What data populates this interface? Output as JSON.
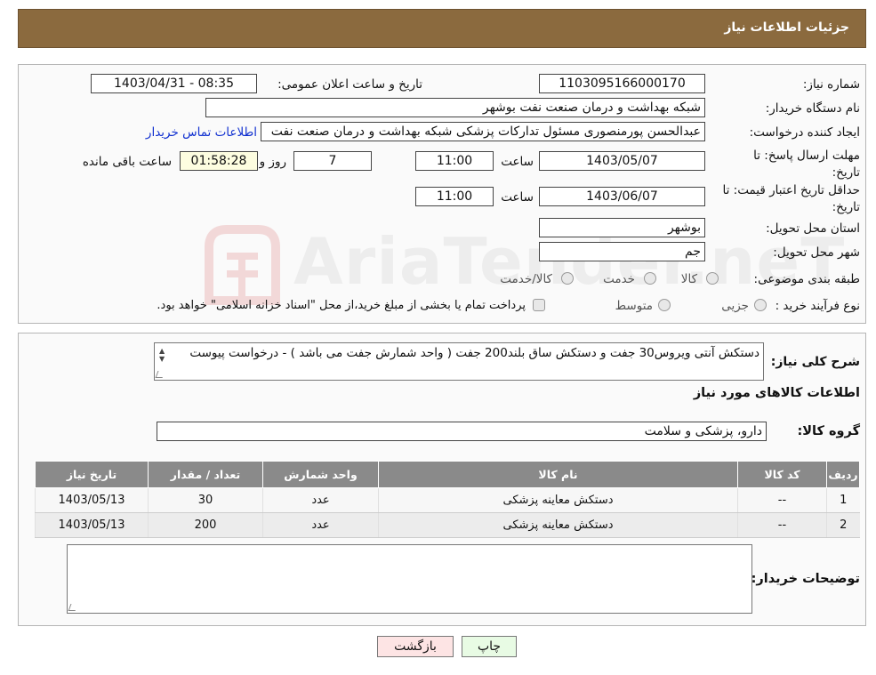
{
  "header": {
    "title": "جزئیات اطلاعات نیاز"
  },
  "form": {
    "need_number_label": "شماره نیاز:",
    "need_number": "1103095166000170",
    "announce_label": "تاریخ و ساعت اعلان عمومی:",
    "announce_value": "1403/04/31 - 08:35",
    "buyer_org_label": "نام دستگاه خریدار:",
    "buyer_org": "شبکه بهداشت و درمان صنعت نفت بوشهر",
    "creator_label": "ایجاد کننده درخواست:",
    "creator": "عبدالحسن پورمنصوری مسئول تدارکات پزشکی شبکه بهداشت و درمان صنعت نفت",
    "contact_link": "اطلاعات تماس خریدار",
    "deadline_label": "مهلت ارسال پاسخ: تا تاریخ:",
    "deadline_date": "1403/05/07",
    "time_label": "ساعت",
    "deadline_time": "11:00",
    "days_value": "7",
    "days_label": "روز و",
    "remaining_time": "01:58:28",
    "remaining_label": "ساعت باقی مانده",
    "min_validity_label": "حداقل تاریخ اعتبار قیمت: تا تاریخ:",
    "validity_date": "1403/06/07",
    "validity_time": "11:00",
    "province_label": "استان محل تحویل:",
    "province": "بوشهر",
    "city_label": "شهر محل تحویل:",
    "city": "جم",
    "category_label": "طبقه بندی موضوعی:",
    "category_options": [
      "کالا",
      "خدمت",
      "کالا/خدمت"
    ],
    "purchase_type_label": "نوع فرآیند خرید :",
    "purchase_options": [
      "جزیی",
      "متوسط"
    ],
    "purchase_note": "پرداخت تمام یا بخشی از مبلغ خرید،از محل \"اسناد خزانه اسلامی\" خواهد بود."
  },
  "summary": {
    "description_label": "شرح کلی نیاز:",
    "description": "دستکش آنتی ویروس30 جفت و دستکش ساق بلند200 جفت  ( واحد شمارش جفت می باشد ) - درخواست پیوست",
    "goods_info_title": "اطلاعات کالاهای مورد نیاز",
    "goods_group_label": "گروه کالا:",
    "goods_group": "دارو، پزشکی و سلامت"
  },
  "table": {
    "headers": [
      "ردیف",
      "کد کالا",
      "نام کالا",
      "واحد شمارش",
      "تعداد / مقدار",
      "تاریخ نیاز"
    ],
    "rows": [
      [
        "1",
        "--",
        "دستکش معاینه پزشکی",
        "عدد",
        "30",
        "1403/05/13"
      ],
      [
        "2",
        "--",
        "دستکش معاینه پزشکی",
        "عدد",
        "200",
        "1403/05/13"
      ]
    ]
  },
  "buyer_notes": {
    "label": "توضیحات خریدار:",
    "value": ""
  },
  "buttons": {
    "print": "چاپ",
    "back": "بازگشت"
  },
  "watermark": {
    "text": "AriaTender.neT"
  },
  "colors": {
    "header_bg": "#8b6a3e",
    "table_header_bg": "#8a8a8a",
    "link": "#1030d0",
    "back_button_bg": "#fde4e4",
    "print_button_bg": "#e8fbe4"
  }
}
